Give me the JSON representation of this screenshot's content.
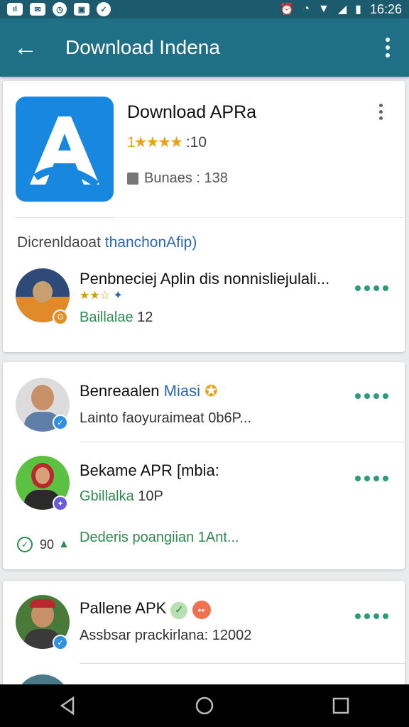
{
  "status_bar": {
    "time": "16:26"
  },
  "app_bar": {
    "title": "Download Indena"
  },
  "app_card": {
    "name": "Download APRa",
    "rating_stars": "1★★★★",
    "rating_count": ":10",
    "bundles": "Bunaes : 138",
    "section_title_a": "Dicrenldaoat",
    "section_title_b": "thanchonAfip)",
    "first_item": {
      "title": "Penbneciej Aplin dis nonnisliejulali...",
      "mini_stars": "★★☆",
      "sub": "Baillalae",
      "sub_value": "12"
    }
  },
  "card2": {
    "item1": {
      "title_a": "Benreaalen ",
      "title_b": "Miasi",
      "sub": "Lainto faoyuraimeat 0b6P..."
    },
    "item2": {
      "title": "Bekame APR [mbia:",
      "sub": "Gbillalka",
      "sub_value": "10P"
    },
    "footer_count": "90",
    "footer_text": "Dederis poangiian 1Ant..."
  },
  "card3": {
    "item1": {
      "title": "Pallene APK",
      "sub": "Assbsar prackirlana: 12002"
    }
  },
  "colors": {
    "app_bar": "#1f6f87",
    "status_bar": "#1c5a6e",
    "accent_green": "#2a9c78",
    "app_icon": "#1887e0",
    "star": "#e8a318"
  }
}
